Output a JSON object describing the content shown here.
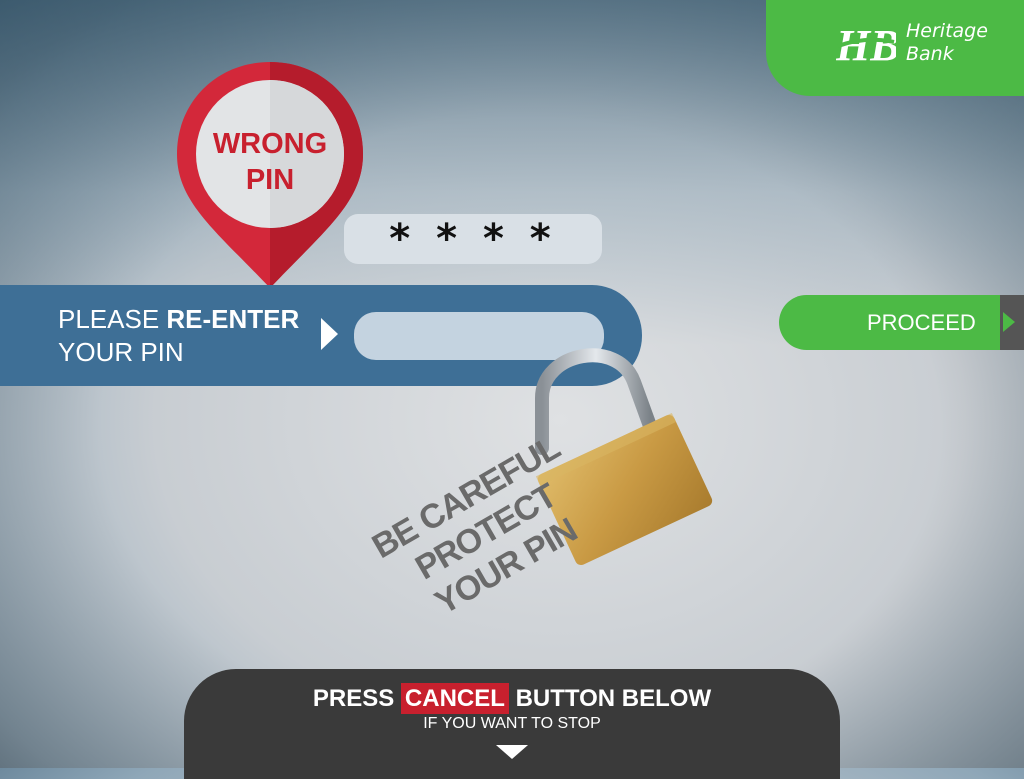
{
  "brand": {
    "name_line1": "Heritage",
    "name_line2": "Bank",
    "color": "#4cba45"
  },
  "marker": {
    "line1": "WRONG",
    "line2": "PIN",
    "color": "#c8202e"
  },
  "pin_display": {
    "masked_value": "****"
  },
  "prompt": {
    "line1_plain": "PLEASE ",
    "line1_bold": "RE-ENTER",
    "line2": "YOUR PIN",
    "color": "#3e6f96"
  },
  "pin_input": {
    "value": ""
  },
  "proceed": {
    "label": "PROCEED"
  },
  "warning": {
    "line1": "BE CAREFUL",
    "line2": "PROTECT",
    "line3": "YOUR PIN"
  },
  "footer": {
    "pre": "PRESS ",
    "cancel": "CANCEL",
    "post": " BUTTON BELOW",
    "subline": "IF YOU WANT TO STOP"
  }
}
